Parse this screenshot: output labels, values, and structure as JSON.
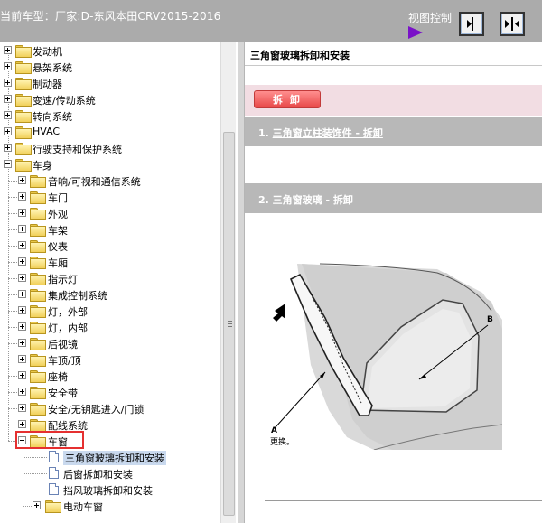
{
  "header": {
    "title": "当前车型：厂家:D-东风本田CRV2015-2016",
    "view_control_label": "视图控制",
    "buttons": [
      {
        "name": "expand-right-icon"
      },
      {
        "name": "split-center-icon"
      }
    ]
  },
  "tree": {
    "items": [
      {
        "label": "发动机",
        "toggle": "plus",
        "level": 0
      },
      {
        "label": "悬架系统",
        "toggle": "plus",
        "level": 0
      },
      {
        "label": "制动器",
        "toggle": "plus",
        "level": 0
      },
      {
        "label": "变速/传动系统",
        "toggle": "plus",
        "level": 0
      },
      {
        "label": "转向系统",
        "toggle": "plus",
        "level": 0
      },
      {
        "label": "HVAC",
        "toggle": "plus",
        "level": 0
      },
      {
        "label": "行驶支持和保护系统",
        "toggle": "plus",
        "level": 0
      },
      {
        "label": "车身",
        "toggle": "minus",
        "level": 0
      },
      {
        "label": "音响/可视和通信系统",
        "toggle": "plus",
        "level": 1
      },
      {
        "label": "车门",
        "toggle": "plus",
        "level": 1
      },
      {
        "label": "外观",
        "toggle": "plus",
        "level": 1
      },
      {
        "label": "车架",
        "toggle": "plus",
        "level": 1
      },
      {
        "label": "仪表",
        "toggle": "plus",
        "level": 1
      },
      {
        "label": "车厢",
        "toggle": "plus",
        "level": 1
      },
      {
        "label": "指示灯",
        "toggle": "plus",
        "level": 1
      },
      {
        "label": "集成控制系统",
        "toggle": "plus",
        "level": 1
      },
      {
        "label": "灯，外部",
        "toggle": "plus",
        "level": 1
      },
      {
        "label": "灯，内部",
        "toggle": "plus",
        "level": 1
      },
      {
        "label": "后视镜",
        "toggle": "plus",
        "level": 1
      },
      {
        "label": "车顶/顶",
        "toggle": "plus",
        "level": 1
      },
      {
        "label": "座椅",
        "toggle": "plus",
        "level": 1
      },
      {
        "label": "安全带",
        "toggle": "plus",
        "level": 1
      },
      {
        "label": "安全/无钥匙进入/门锁",
        "toggle": "plus",
        "level": 1
      },
      {
        "label": "配线系统",
        "toggle": "plus",
        "level": 1
      },
      {
        "label": "车窗",
        "toggle": "minus",
        "level": 1
      },
      {
        "label": "三角窗玻璃拆卸和安装",
        "toggle": "none",
        "level": 2,
        "doc": true,
        "selected": true
      },
      {
        "label": "后窗拆卸和安装",
        "toggle": "none",
        "level": 2,
        "doc": true
      },
      {
        "label": "挡风玻璃拆卸和安装",
        "toggle": "none",
        "level": 2,
        "doc": true
      },
      {
        "label": "电动车窗",
        "toggle": "plus",
        "level": 2
      }
    ]
  },
  "content": {
    "page_title": "三角窗玻璃拆卸和安装",
    "remove_button": "拆 卸",
    "step1_prefix": "1. ",
    "step1_link": "三角窗立柱装饰件 - 拆卸",
    "step2": "2. 三角窗玻璃 - 拆卸",
    "callout_a": "A",
    "callout_a_note": "更换。",
    "callout_b": "B"
  },
  "colors": {
    "header_bg": "#ababab",
    "highlight_box": "#e53030",
    "remove_button": "#e84848",
    "remove_band": "#f2dde3",
    "step_bar": "#b8b8b8",
    "selected_item": "#c9d9ee"
  }
}
